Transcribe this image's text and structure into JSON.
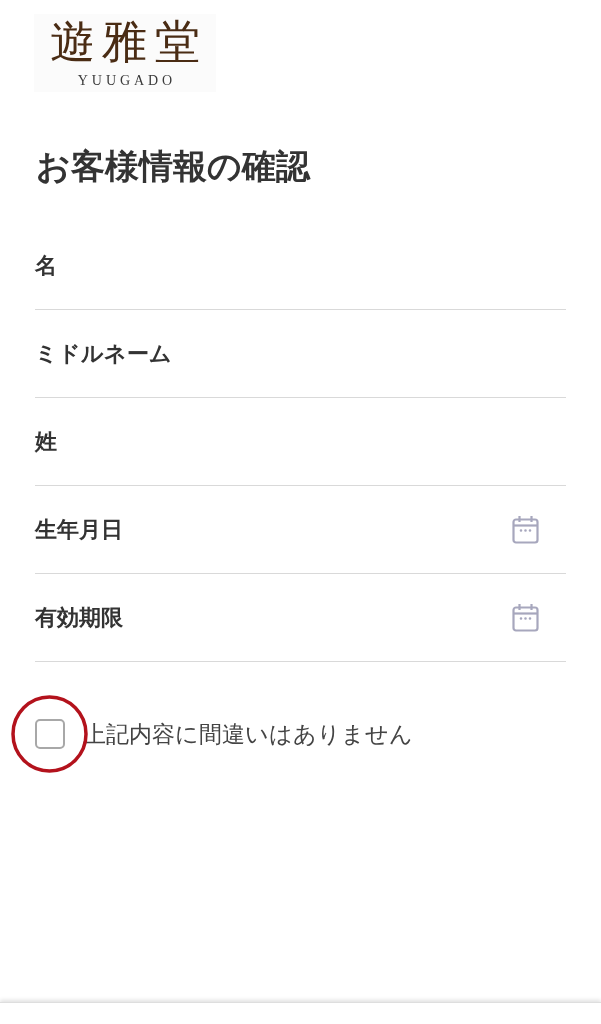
{
  "logo": {
    "name": "遊雅堂",
    "subtitle": "YUUGADO"
  },
  "title": "お客様情報の確認",
  "fields": [
    {
      "kind": "text",
      "label": "名"
    },
    {
      "kind": "text",
      "label": "ミドルネーム"
    },
    {
      "kind": "text",
      "label": "姓"
    },
    {
      "kind": "date",
      "label": "生年月日"
    },
    {
      "kind": "date",
      "label": "有効期限"
    }
  ],
  "consent": {
    "label": "上記内容に間違いはありません",
    "checked": false,
    "highlighted": true
  }
}
